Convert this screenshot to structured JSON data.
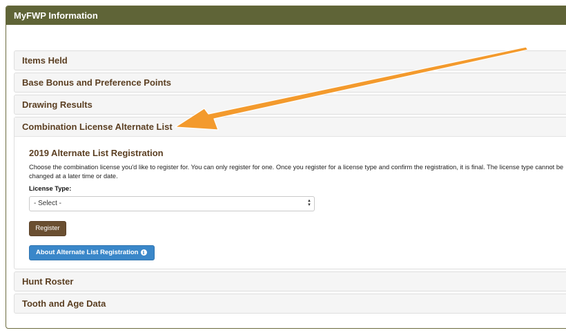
{
  "panel": {
    "title": "MyFWP Information"
  },
  "accordion": {
    "items_held": "Items Held",
    "points": "Base Bonus and Preference Points",
    "drawing": "Drawing Results",
    "combination": "Combination License Alternate List",
    "hunt_roster": "Hunt Roster",
    "tooth_age": "Tooth and Age Data"
  },
  "registration": {
    "title": "2019 Alternate List Registration",
    "description": "Choose the combination license you'd like to register for. You can only register for one. Once you register for a license type and confirm the registration, it is final. The license type cannot be changed at a later time or date.",
    "license_type_label": "License Type:",
    "select_value": "- Select -",
    "register_button": "Register",
    "about_button": "About Alternate List Registration"
  },
  "colors": {
    "header_bg": "#5f6437",
    "title_brown": "#5b3f22",
    "register_bg": "#6a4f31",
    "about_bg": "#3a87c9",
    "arrow_orange": "#f39a2d"
  },
  "icons": {
    "info": "info-circle-icon",
    "select": "select-arrows-icon",
    "annotation": "annotation-arrow-icon"
  }
}
